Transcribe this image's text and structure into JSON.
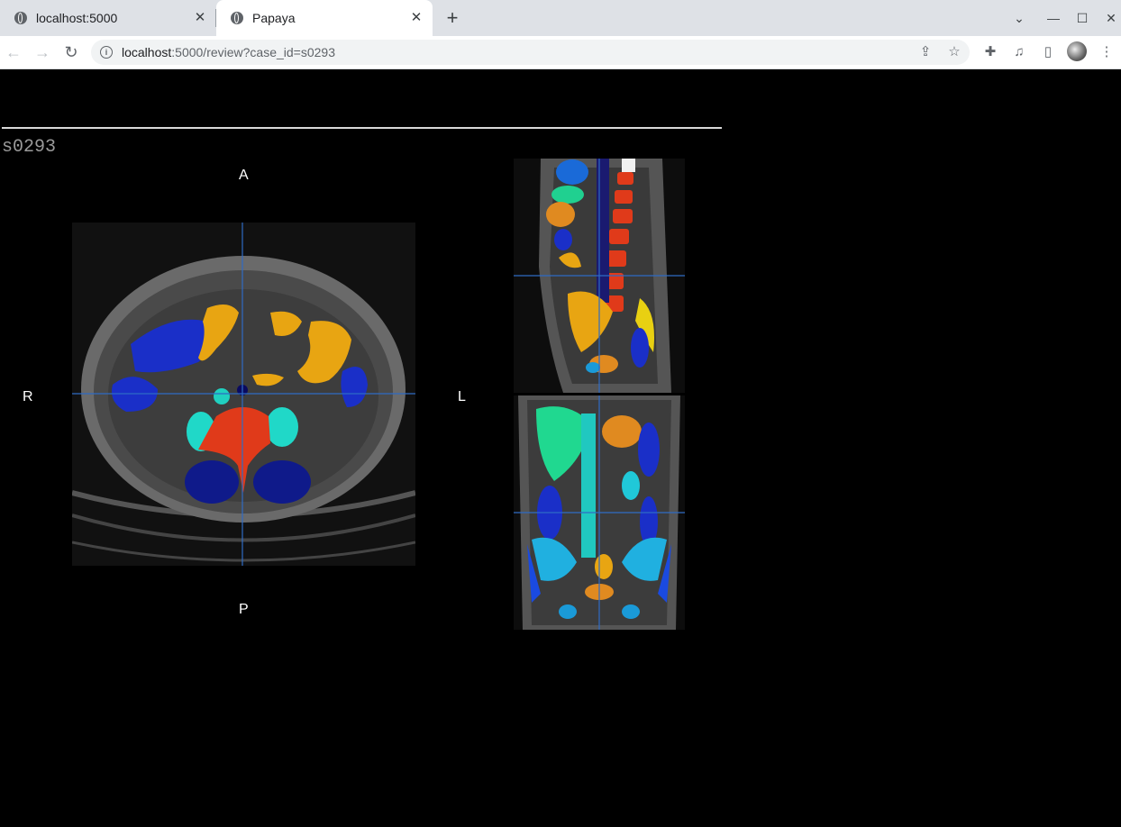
{
  "browser": {
    "tabs": [
      {
        "title": "localhost:5000",
        "active": false
      },
      {
        "title": "Papaya",
        "active": true
      }
    ],
    "url_host": "localhost",
    "url_rest": ":5000/review?case_id=s0293"
  },
  "viewer": {
    "case_id": "s0293",
    "orientation_labels": {
      "anterior": "A",
      "posterior": "P",
      "right": "R",
      "left": "L"
    },
    "crosshair_color": "#2f6bc4"
  }
}
